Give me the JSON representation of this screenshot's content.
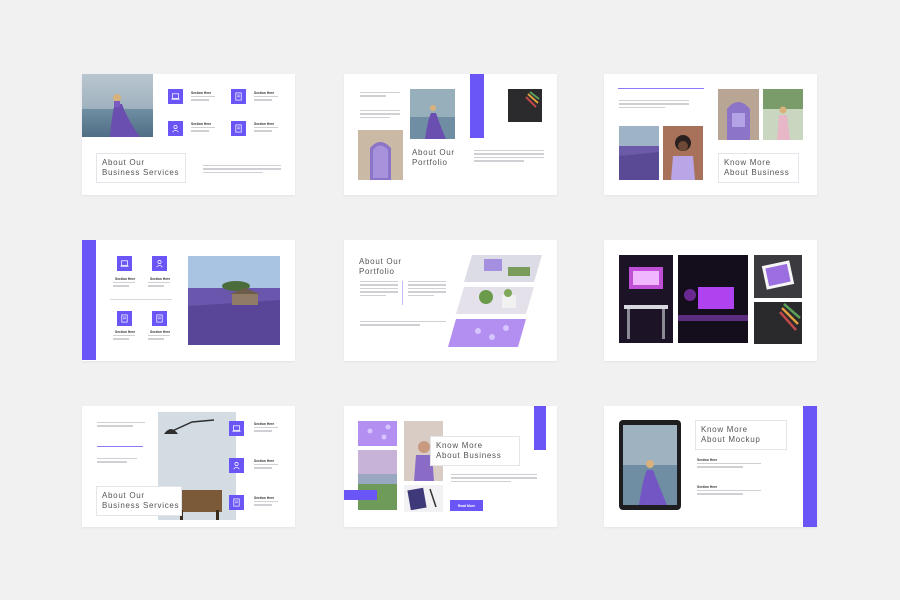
{
  "colors": {
    "accent": "#6a55f6",
    "background": "#f1f1f2",
    "slide": "#ffffff"
  },
  "section_label": "Section Here",
  "button_label": "Read More",
  "slides": {
    "s1": {
      "title_line1": "About Our",
      "title_line2": "Business Services"
    },
    "s2": {
      "title_line1": "About Our",
      "title_line2": "Portfolio"
    },
    "s3": {
      "title_line1": "Know More",
      "title_line2": "About Business"
    },
    "s5": {
      "title_line1": "About Our",
      "title_line2": "Portfolio"
    },
    "s7": {
      "title_line1": "About Our",
      "title_line2": "Business Services"
    },
    "s8": {
      "title_line1": "Know More",
      "title_line2": "About Business"
    },
    "s9": {
      "title_line1": "Know More",
      "title_line2": "About Mockup"
    }
  },
  "icons": [
    "laptop-icon",
    "document-icon",
    "person-icon",
    "document-icon"
  ]
}
